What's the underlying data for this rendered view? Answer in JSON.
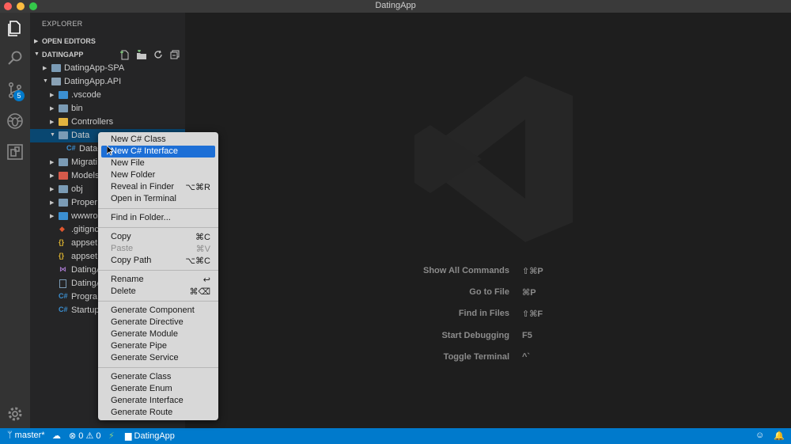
{
  "window": {
    "title": "DatingApp"
  },
  "activity": {
    "scm_badge": "5"
  },
  "sidebar": {
    "title": "EXPLORER",
    "open_editors": "OPEN EDITORS",
    "project": "DATINGAPP",
    "tree": [
      {
        "label": "DatingApp-SPA",
        "kind": "folder"
      },
      {
        "label": "DatingApp.API",
        "kind": "folder"
      },
      {
        "label": ".vscode",
        "kind": "folder"
      },
      {
        "label": "bin",
        "kind": "folder"
      },
      {
        "label": "Controllers",
        "kind": "folder"
      },
      {
        "label": "Data",
        "kind": "folder"
      },
      {
        "label": "DataC",
        "kind": "csharp"
      },
      {
        "label": "Migrati",
        "kind": "folder"
      },
      {
        "label": "Models",
        "kind": "folder"
      },
      {
        "label": "obj",
        "kind": "folder"
      },
      {
        "label": "Proper",
        "kind": "folder"
      },
      {
        "label": "wwwro",
        "kind": "folder"
      },
      {
        "label": ".gitignc",
        "kind": "git"
      },
      {
        "label": "appset",
        "kind": "json"
      },
      {
        "label": "appset",
        "kind": "json"
      },
      {
        "label": "DatingA",
        "kind": "vs"
      },
      {
        "label": "DatingA",
        "kind": "file"
      },
      {
        "label": "Progra",
        "kind": "csharp"
      },
      {
        "label": "Startup",
        "kind": "csharp"
      }
    ]
  },
  "context_menu": {
    "groups": [
      [
        {
          "label": "New C# Class",
          "key": ""
        },
        {
          "label": "New C# Interface",
          "key": "",
          "highlighted": true
        },
        {
          "label": "New File",
          "key": ""
        },
        {
          "label": "New Folder",
          "key": ""
        },
        {
          "label": "Reveal in Finder",
          "key": "⌥⌘R"
        },
        {
          "label": "Open in Terminal",
          "key": ""
        }
      ],
      [
        {
          "label": "Find in Folder...",
          "key": ""
        }
      ],
      [
        {
          "label": "Copy",
          "key": "⌘C"
        },
        {
          "label": "Paste",
          "key": "⌘V",
          "disabled": true
        },
        {
          "label": "Copy Path",
          "key": "⌥⌘C"
        }
      ],
      [
        {
          "label": "Rename",
          "key": "↩"
        },
        {
          "label": "Delete",
          "key": "⌘⌫"
        }
      ],
      [
        {
          "label": "Generate Component",
          "key": ""
        },
        {
          "label": "Generate Directive",
          "key": ""
        },
        {
          "label": "Generate Module",
          "key": ""
        },
        {
          "label": "Generate Pipe",
          "key": ""
        },
        {
          "label": "Generate Service",
          "key": ""
        }
      ],
      [
        {
          "label": "Generate Class",
          "key": ""
        },
        {
          "label": "Generate Enum",
          "key": ""
        },
        {
          "label": "Generate Interface",
          "key": ""
        },
        {
          "label": "Generate Route",
          "key": ""
        }
      ]
    ]
  },
  "editor": {
    "shortcuts": [
      {
        "name": "Show All Commands",
        "key": "⇧⌘P"
      },
      {
        "name": "Go to File",
        "key": "⌘P"
      },
      {
        "name": "Find in Files",
        "key": "⇧⌘F"
      },
      {
        "name": "Start Debugging",
        "key": "F5"
      },
      {
        "name": "Toggle Terminal",
        "key": "^`"
      }
    ]
  },
  "status": {
    "branch": "master*",
    "errors": "0",
    "warnings": "0",
    "project": "DatingApp"
  },
  "colors": {
    "accent": "#007acc",
    "menu_highlight": "#1d6fd6",
    "selection": "#094771"
  }
}
